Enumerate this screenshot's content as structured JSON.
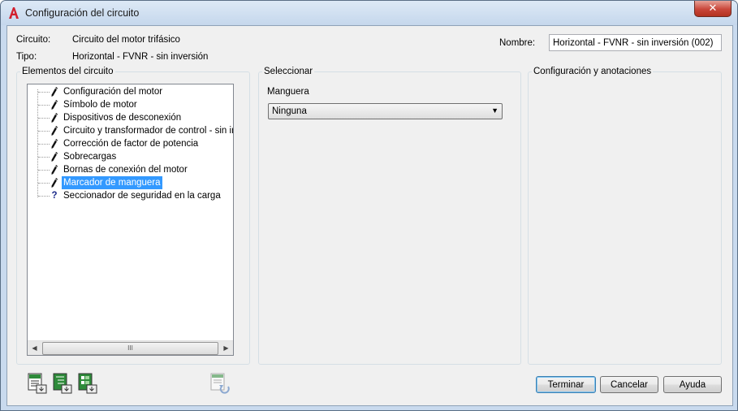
{
  "window": {
    "title": "Configuración del circuito",
    "close_glyph": "✕",
    "app_icon": "autocad-a-icon"
  },
  "info": {
    "circuit_label": "Circuito:",
    "circuit_value": "Circuito del motor trifásico",
    "type_label": "Tipo:",
    "type_value": "Horizontal - FVNR - sin inversión",
    "name_label": "Nombre:",
    "name_value": "Horizontal - FVNR - sin inversión (002)"
  },
  "elements_panel": {
    "title": "Elementos del circuito",
    "items": [
      {
        "label": "Configuración del motor",
        "icon": "pencil-icon",
        "selected": false
      },
      {
        "label": "Símbolo de motor",
        "icon": "pencil-icon",
        "selected": false
      },
      {
        "label": "Dispositivos de desconexión",
        "icon": "pencil-icon",
        "selected": false
      },
      {
        "label": "Circuito y transformador de control - sin inver",
        "icon": "pencil-icon",
        "selected": false
      },
      {
        "label": "Corrección de factor de potencia",
        "icon": "pencil-icon",
        "selected": false
      },
      {
        "label": "Sobrecargas",
        "icon": "pencil-icon",
        "selected": false
      },
      {
        "label": "Bornas de conexión del motor",
        "icon": "pencil-icon",
        "selected": false
      },
      {
        "label": "Marcador de manguera",
        "icon": "pencil-icon",
        "selected": true
      },
      {
        "label": "Seccionador de seguridad en la carga",
        "icon": "question-icon",
        "selected": false
      }
    ],
    "scroll_left": "◀",
    "scroll_right": "▶",
    "scroll_grip": "III"
  },
  "select_panel": {
    "title": "Seleccionar",
    "field_label": "Manguera",
    "selected_value": "Ninguna",
    "arrow": "▼"
  },
  "config_panel": {
    "title": "Configuración y anotaciones"
  },
  "buttons": {
    "finish": "Terminar",
    "cancel": "Cancelar",
    "help": "Ayuda"
  },
  "colors": {
    "selection": "#3399ff",
    "dialog_bg": "#f0f0f0",
    "title_bar": "#c9daee",
    "close_button": "#c9463a",
    "app_icon_red": "#d2202e",
    "tool_icon_green": "#2e8b3a"
  }
}
